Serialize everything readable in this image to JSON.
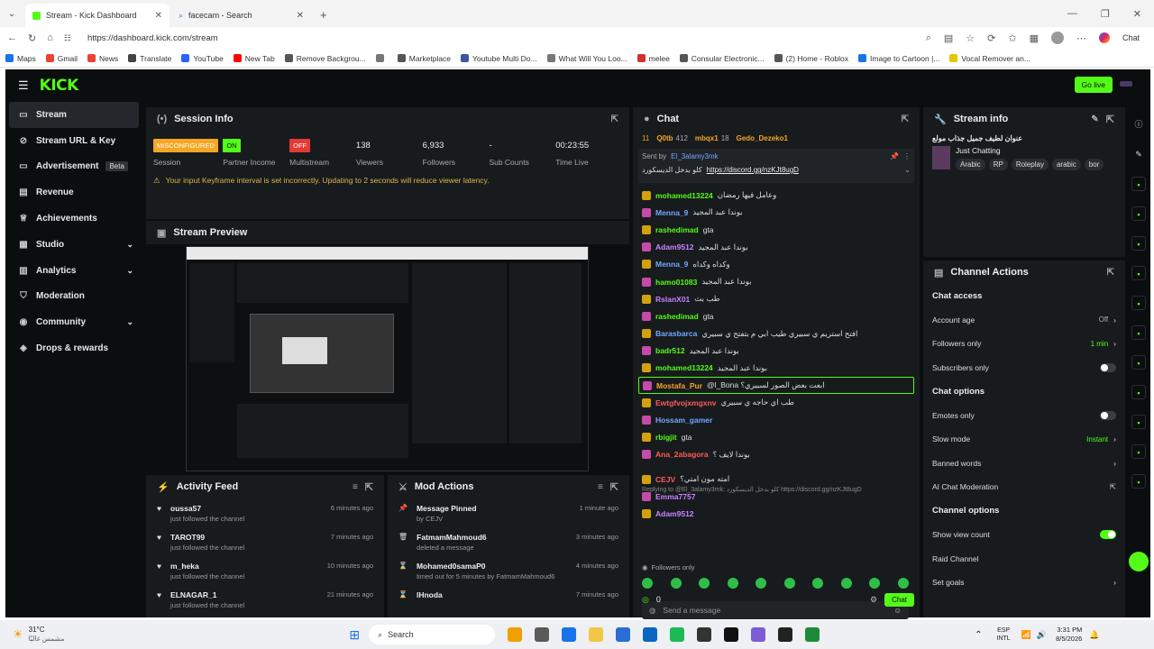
{
  "browser": {
    "tabs": [
      {
        "title": "Stream - Kick Dashboard",
        "active": true
      },
      {
        "title": "facecam - Search",
        "active": false
      }
    ],
    "url": "https://dashboard.kick.com/stream",
    "chat_label": "Chat",
    "bookmarks": [
      "Maps",
      "Gmail",
      "News",
      "Translate",
      "YouTube",
      "New Tab",
      "Remove Backgrou...",
      "",
      "Marketplace",
      "Youtube Multi Do...",
      "What Will You Loo...",
      "melee",
      "Consular Electronic...",
      "(2) Home - Roblox",
      "Image to Cartoon |...",
      "Vocal Remover an..."
    ]
  },
  "app": {
    "logo": "KICK",
    "go_live": "Go live",
    "nav": [
      {
        "label": "Stream",
        "icon": "video-icon",
        "active": true
      },
      {
        "label": "Stream URL & Key",
        "icon": "link-icon"
      },
      {
        "label": "Advertisement",
        "icon": "monitor-icon",
        "badge": "Beta"
      },
      {
        "label": "Revenue",
        "icon": "dollar-icon"
      },
      {
        "label": "Achievements",
        "icon": "trophy-icon"
      },
      {
        "label": "Studio",
        "icon": "layout-icon",
        "chevron": true
      },
      {
        "label": "Analytics",
        "icon": "chart-icon",
        "chevron": true
      },
      {
        "label": "Moderation",
        "icon": "shield-icon"
      },
      {
        "label": "Community",
        "icon": "users-icon",
        "chevron": true
      },
      {
        "label": "Drops & rewards",
        "icon": "gift-icon"
      }
    ],
    "session": {
      "title": "Session Info",
      "stats": [
        {
          "value": "MISCONFIGURED",
          "label": "Session",
          "type": "badge",
          "color": "#f5a623"
        },
        {
          "value": "ON",
          "label": "Partner Income",
          "type": "badge",
          "color": "#53fc18"
        },
        {
          "value": "OFF",
          "label": "Multistream",
          "type": "badge",
          "color": "#e53935"
        },
        {
          "value": "138",
          "label": "Viewers"
        },
        {
          "value": "6,933",
          "label": "Followers"
        },
        {
          "value": "-",
          "label": "Sub Counts"
        },
        {
          "value": "00:23:55",
          "label": "Time Live"
        }
      ],
      "warning": "Your input Keyframe interval is set incorrectly. Updating to 2 seconds will reduce viewer latency."
    },
    "preview": {
      "title": "Stream Preview"
    },
    "activity": {
      "title": "Activity Feed",
      "items": [
        {
          "who": "oussa57",
          "what": "just followed the channel",
          "when": "6 minutes ago"
        },
        {
          "who": "TAROT99",
          "what": "just followed the channel",
          "when": "7 minutes ago"
        },
        {
          "who": "m_heka",
          "what": "just followed the channel",
          "when": "10 minutes ago"
        },
        {
          "who": "ELNAGAR_1",
          "what": "just followed the channel",
          "when": "21 minutes ago"
        }
      ]
    },
    "mod": {
      "title": "Mod Actions",
      "items": [
        {
          "who": "Message Pinned",
          "what": "by CEJV",
          "when": "1 minute ago",
          "icon": "pin-icon"
        },
        {
          "who": "FatmamMahmoud6",
          "what": "deleted a message",
          "when": "3 minutes ago",
          "icon": "trash-icon"
        },
        {
          "who": "Mohamed0samaP0",
          "what": "timed out for 5 minutes by FatmamMahmoud6",
          "when": "4 minutes ago",
          "icon": "hourglass-icon"
        },
        {
          "who": "lHnoda",
          "what": "",
          "when": "7 minutes ago",
          "icon": "hourglass-icon"
        }
      ]
    },
    "chat": {
      "title": "Chat",
      "top": [
        {
          "name": "Q0tb",
          "v": "412"
        },
        {
          "name": "mbqx1",
          "v": "18"
        },
        {
          "name": "Gedo_Dezeko1",
          "v": ""
        }
      ],
      "top_count": "11",
      "pinned_by": "Sent by",
      "pinned_user": "El_3alamy3mk",
      "pinned_text": "كلو بدخل الديسكورد",
      "pinned_link": "https://discord.gg/nzKJt8ugD",
      "messages": [
        {
          "user": "mohamed13224",
          "color": "#53fc18",
          "text": "وعامل فيها رمضان"
        },
        {
          "user": "Menna_9",
          "color": "#6fa8ff",
          "text": "بوندا عبد المجيد"
        },
        {
          "user": "rashedimad",
          "color": "#53fc18",
          "text": "gta"
        },
        {
          "user": "Adam9512",
          "color": "#c583ff",
          "text": "بوندا عبد المجيد"
        },
        {
          "user": "Menna_9",
          "color": "#6fa8ff",
          "text": "وكداه وكداه"
        },
        {
          "user": "hamo01083",
          "color": "#53fc18",
          "text": "بوندا عبد المجيد"
        },
        {
          "user": "RslanX01",
          "color": "#c583ff",
          "text": "طب بث"
        },
        {
          "user": "rashedimad",
          "color": "#53fc18",
          "text": "gta"
        },
        {
          "user": "Barasbarca",
          "color": "#6fa8ff",
          "text": "افتح استريم ي سبيري طيب ابي م بتفتح ي سبيري"
        },
        {
          "user": "badr512",
          "color": "#53fc18",
          "text": "بوندا عبد المجيد"
        },
        {
          "user": "mohamed13224",
          "color": "#53fc18",
          "text": "بوندا عبد المجيد"
        },
        {
          "user": "Mostafa_Pur",
          "color": "#f5a623",
          "text": "@l_Bona ابعت بعض الصور لسبيري؟",
          "highlight": true
        },
        {
          "user": "Ewtgfvojxmgxnv",
          "color": "#ff5a5a",
          "text": "طب اي حاجه ي سبيري"
        },
        {
          "user": "Hossam_gamer",
          "color": "#6fa8ff",
          "text": ""
        },
        {
          "user": "rbigjit",
          "color": "#53fc18",
          "text": "gta"
        },
        {
          "user": "Ana_2abagora",
          "color": "#ff5a5a",
          "text": "بوندا لايف ؟"
        },
        {
          "user": "CEJV",
          "color": "#ff5a5a",
          "text": "امته مون امتي؟"
        },
        {
          "user": "Emma7757",
          "color": "#c583ff",
          "text": ""
        },
        {
          "user": "Adam9512",
          "color": "#c583ff",
          "text": ""
        }
      ],
      "reply_to": "Replying to @El_3alamy3mk: كلو بدخل الديسكورد https://discord.gg/nzKJt8ugD",
      "followers_only": "Followers only",
      "placeholder": "Send a message",
      "points": "0",
      "send": "Chat"
    },
    "stream_info": {
      "title": "Stream info",
      "stream_title": "عنوان لطيف جميل جذاب مولع",
      "category": "Just Chatting",
      "tags": [
        "Arabic",
        "RP",
        "Roleplay",
        "arabic",
        "bor"
      ]
    },
    "channel_actions": {
      "title": "Channel Actions",
      "sections": [
        {
          "heading": "Chat access",
          "rows": [
            {
              "label": "Account age",
              "value": "Off",
              "kind": "chevron"
            },
            {
              "label": "Followers only",
              "value": "1 min",
              "kind": "chevron",
              "green": true
            },
            {
              "label": "Subscribers only",
              "kind": "toggle",
              "on": false
            }
          ]
        },
        {
          "heading": "Chat options",
          "rows": [
            {
              "label": "Emotes only",
              "kind": "toggle",
              "on": false
            },
            {
              "label": "Slow mode",
              "value": "Instant",
              "kind": "chevron",
              "green": true
            },
            {
              "label": "Banned words",
              "kind": "chevron"
            },
            {
              "label": "AI Chat Moderation",
              "kind": "ext"
            }
          ]
        },
        {
          "heading": "Channel options",
          "rows": [
            {
              "label": "Show view count",
              "kind": "toggle",
              "on": true
            },
            {
              "label": "Raid Channel",
              "kind": "none"
            },
            {
              "label": "Set goals",
              "kind": "chevron"
            }
          ]
        }
      ]
    }
  },
  "taskbar": {
    "weather_temp": "31°C",
    "weather_text": "مشمس غالبًا",
    "search": "Search",
    "lang": "ESP",
    "lang2": "INTL",
    "time": "3:31 PM",
    "date": "8/5/2026"
  }
}
